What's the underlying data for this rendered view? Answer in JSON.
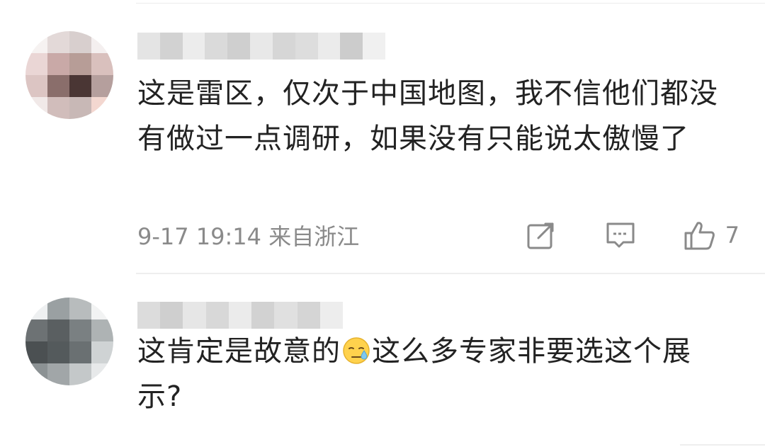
{
  "comments": [
    {
      "text": "这是雷区，仅次于中国地图，我不信他们都没有做过一点调研，如果没有只能说太傲慢了",
      "timestamp": "9-17 19:14",
      "location": "来自浙江",
      "like_count": "7",
      "icons": {
        "repost": "share-icon",
        "comment": "comment-icon",
        "like": "thumbs-up-icon"
      }
    },
    {
      "text_before_emoji": "这肯定是故意的",
      "emoji": "sweat-face-emoji",
      "text_after_emoji": "这么多专家非要选这个展示?"
    }
  ],
  "colors": {
    "text": "#222222",
    "meta": "#8a8a8a",
    "divider": "#eeeeee"
  }
}
